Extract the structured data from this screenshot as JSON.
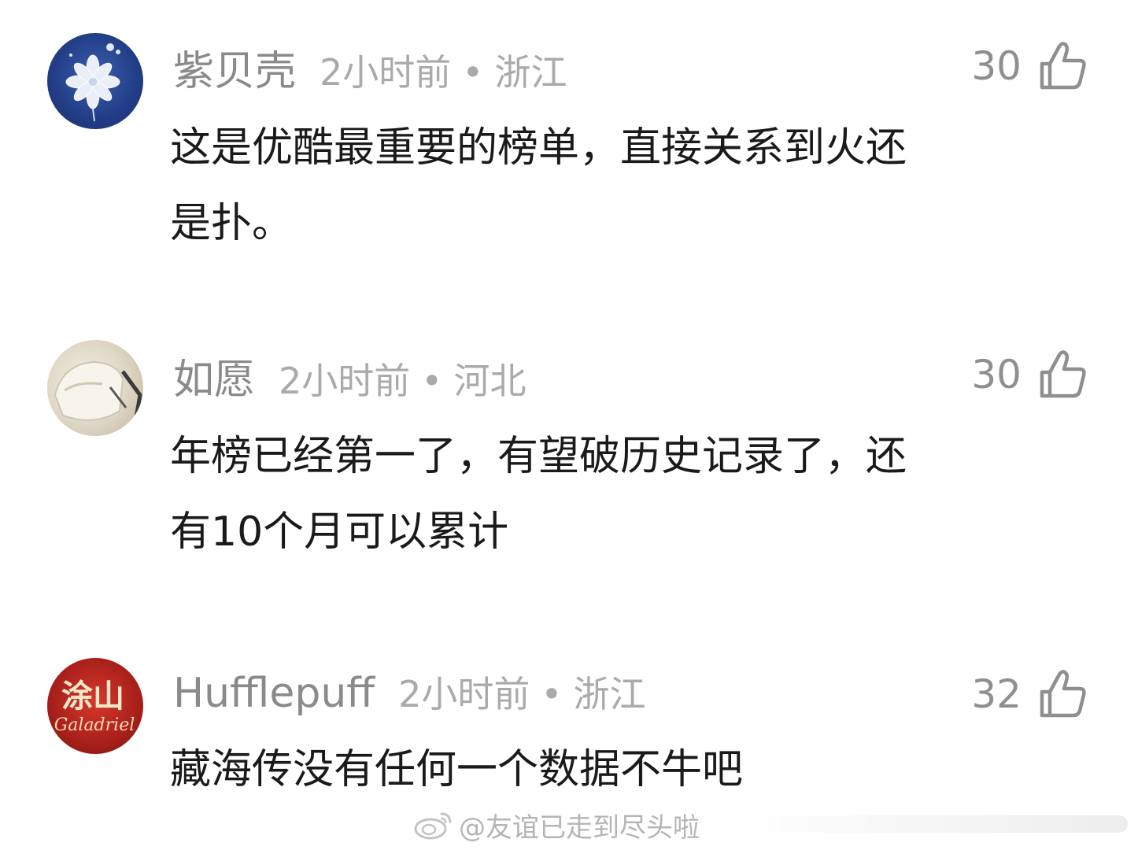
{
  "comments": [
    {
      "username": "紫贝壳",
      "time": "2小时前",
      "separator": "•",
      "region": "浙江",
      "likes": "30",
      "text_lines": [
        "这是优酷最重要的榜单，直接关系到火还",
        "是扑。"
      ],
      "avatar_icon": "flower-avatar-icon"
    },
    {
      "username": "如愿",
      "time": "2小时前",
      "separator": "•",
      "region": "河北",
      "likes": "30",
      "text_lines": [
        "年榜已经第一了，有望破历史记录了，还",
        "有10个月可以累计"
      ],
      "avatar_icon": "photo-avatar-icon"
    },
    {
      "username": "Hufflepuff",
      "time": "2小时前",
      "separator": "•",
      "region": "浙江",
      "likes": "32",
      "text_lines": [
        "藏海传没有任何一个数据不牛吧"
      ],
      "avatar_icon": "calligraphy-avatar-icon",
      "avatar_text": [
        "涂山",
        "Galadriel"
      ]
    }
  ],
  "like_icon": "thumbs-up-icon",
  "watermark": {
    "icon": "weibo-logo-icon",
    "text": "@友谊已走到尽头啦"
  }
}
